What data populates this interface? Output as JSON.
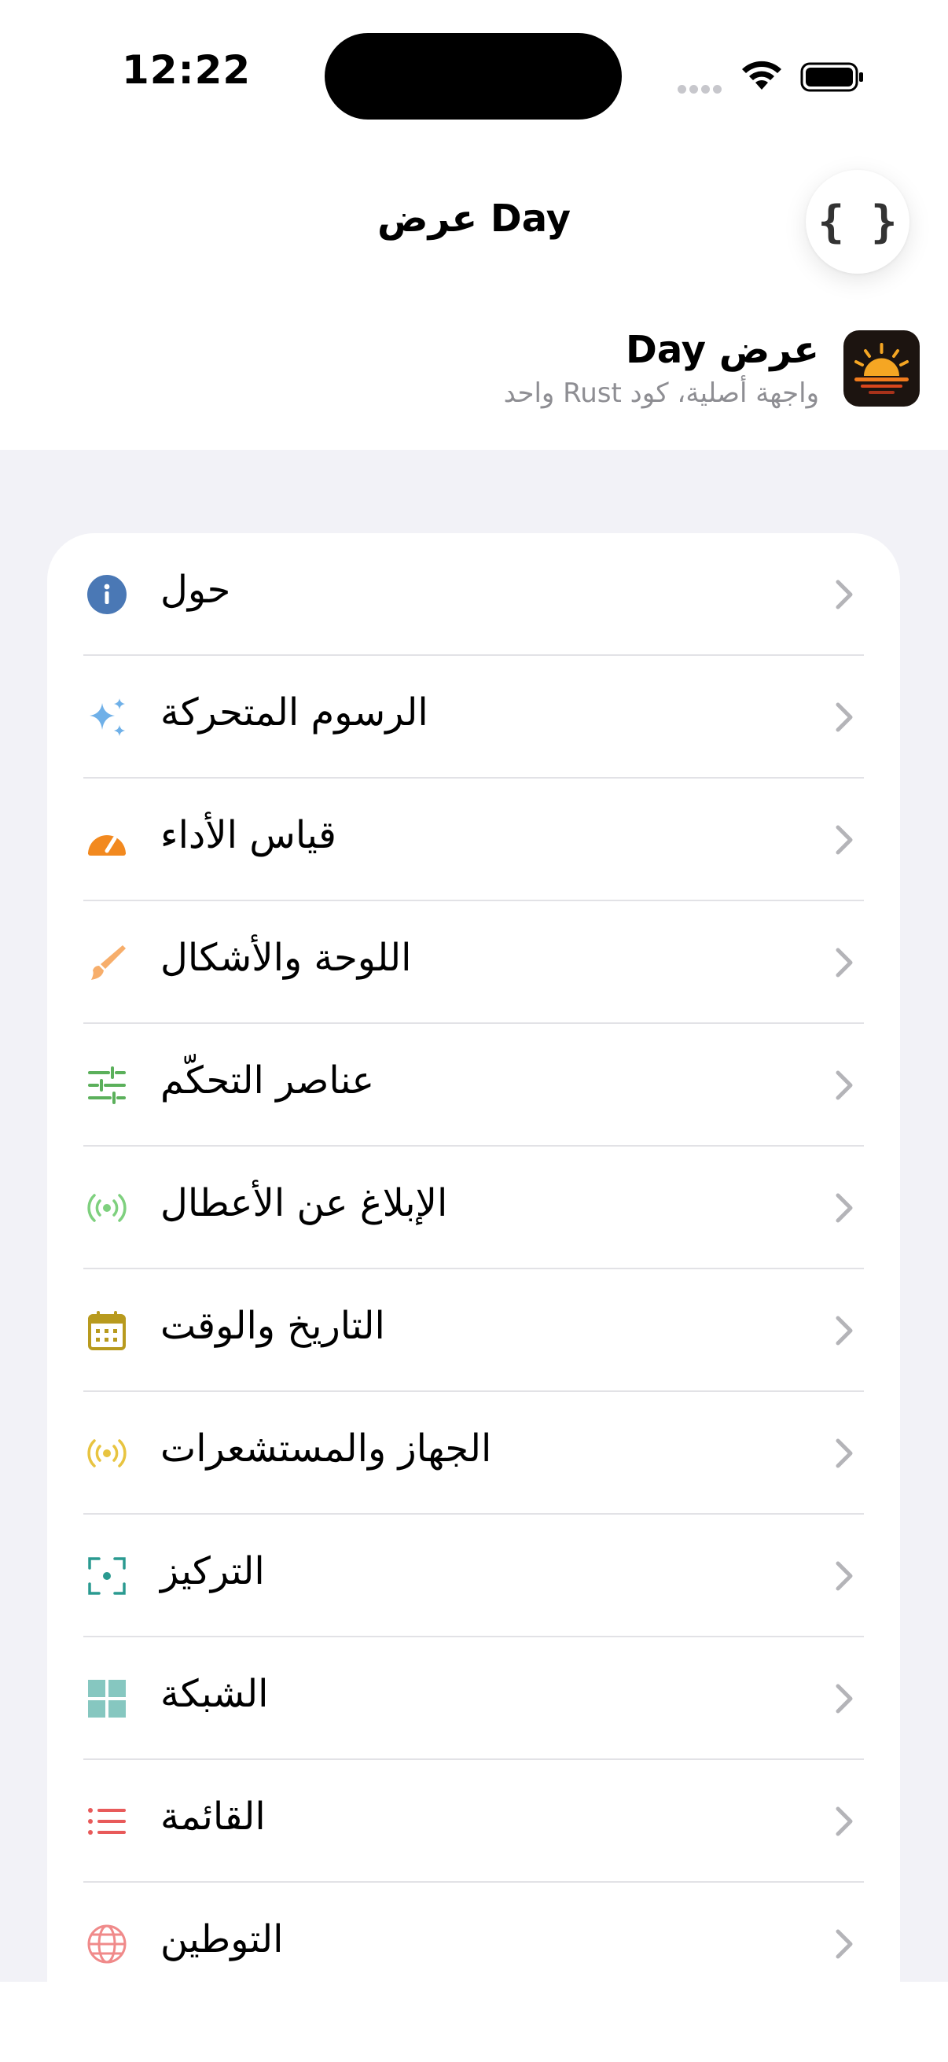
{
  "status_bar": {
    "time": "12:22"
  },
  "nav": {
    "title": "عرض Day",
    "code_button_icon": "curly-braces-icon",
    "code_glyph": "{ }"
  },
  "app": {
    "name": "عرض Day",
    "subtitle": "واجهة أصلية، كود Rust واحد",
    "icon": "sunrise-icon"
  },
  "menu": {
    "items": [
      {
        "label": "حول",
        "icon": "info-icon",
        "color": "#4a78b5"
      },
      {
        "label": "الرسوم المتحركة",
        "icon": "sparkles-icon",
        "color": "#6fb0e8"
      },
      {
        "label": "قياس الأداء",
        "icon": "speedometer-icon",
        "color": "#f2891f"
      },
      {
        "label": "اللوحة والأشكال",
        "icon": "paintbrush-icon",
        "color": "#f7ae6b"
      },
      {
        "label": "عناصر التحكّم",
        "icon": "sliders-icon",
        "color": "#5bb05b"
      },
      {
        "label": "الإبلاغ عن الأعطال",
        "icon": "broadcast-icon",
        "color": "#7ed07e"
      },
      {
        "label": "التاريخ والوقت",
        "icon": "calendar-icon",
        "color": "#b89a1e"
      },
      {
        "label": "الجهاز والمستشعرات",
        "icon": "sensor-icon",
        "color": "#e8c440"
      },
      {
        "label": "التركيز",
        "icon": "focus-icon",
        "color": "#2a9a90"
      },
      {
        "label": "الشبكة",
        "icon": "grid-icon",
        "color": "#86c7c0"
      },
      {
        "label": "القائمة",
        "icon": "list-icon",
        "color": "#e85a5a"
      },
      {
        "label": "التوطين",
        "icon": "globe-icon",
        "color": "#f08a8a"
      }
    ]
  }
}
